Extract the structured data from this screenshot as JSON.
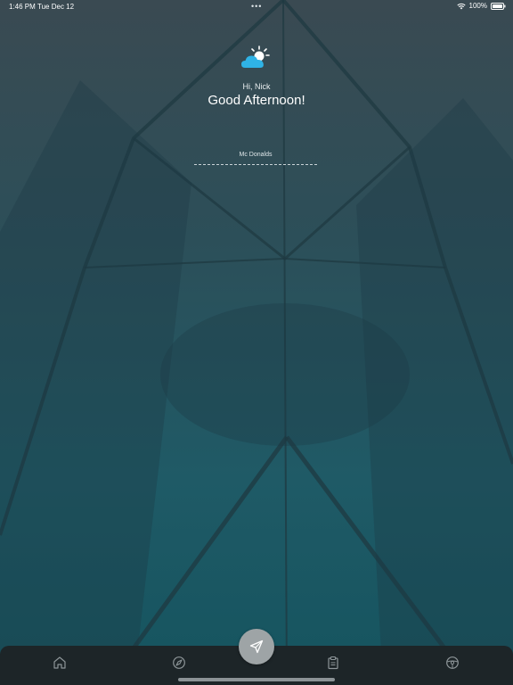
{
  "status_bar": {
    "time": "1:46 PM",
    "date": "Tue Dec 12",
    "dots": "•••",
    "battery": "100%",
    "wifi_icon": "wifi-icon",
    "battery_icon": "battery-icon"
  },
  "greeting": {
    "weather_icon": "partly-cloudy-icon",
    "name_line": "Hi, Nick",
    "title": "Good Afternoon!"
  },
  "location": {
    "value": "Mc Donalds"
  },
  "tab_bar": {
    "tabs": [
      {
        "name": "home",
        "icon": "home-icon"
      },
      {
        "name": "compass",
        "icon": "compass-icon"
      },
      {
        "name": "send",
        "icon": "send-icon"
      },
      {
        "name": "clipboard",
        "icon": "clipboard-icon"
      },
      {
        "name": "steering-wheel",
        "icon": "steering-wheel-icon"
      }
    ]
  },
  "colors": {
    "accent": "#2fb3e6",
    "tab_bar_bg": "#1d2528",
    "fab_bg": "#9ea4a6"
  }
}
